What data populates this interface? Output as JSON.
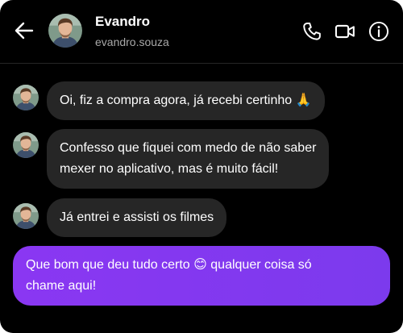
{
  "header": {
    "contact_name": "Evandro",
    "contact_handle": "evandro.souza",
    "back_icon": "back-arrow-icon",
    "phone_icon": "phone-icon",
    "video_icon": "video-camera-icon",
    "info_icon": "info-icon"
  },
  "messages": [
    {
      "direction": "incoming",
      "text": "Oi, fiz a compra agora, já recebi certinho 🙏"
    },
    {
      "direction": "incoming",
      "text": "Confesso que fiquei com medo de não saber\nmexer no aplicativo, mas é muito fácil!"
    },
    {
      "direction": "incoming",
      "text": "Já entrei e assisti os filmes"
    },
    {
      "direction": "outgoing",
      "text": "Que bom que deu tudo certo 😊 qualquer coisa só\nchame aqui!"
    }
  ],
  "colors": {
    "background": "#000000",
    "incoming_bubble": "#262626",
    "outgoing_bubble": "#7c3aed",
    "secondary_text": "#a8a8a8"
  }
}
